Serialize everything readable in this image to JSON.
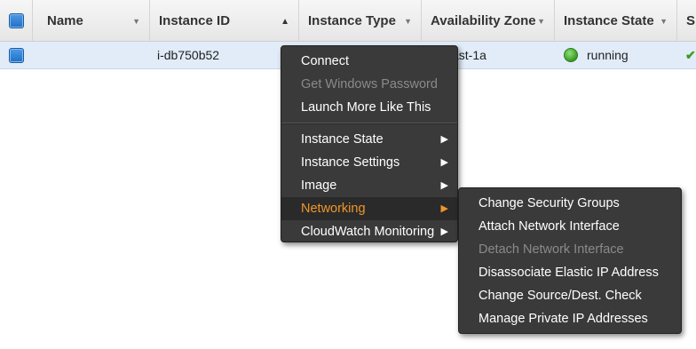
{
  "table": {
    "columns": [
      {
        "label": "Name"
      },
      {
        "label": "Instance ID"
      },
      {
        "label": "Instance Type"
      },
      {
        "label": "Availability Zone"
      },
      {
        "label": "Instance State"
      },
      {
        "label": "S"
      }
    ],
    "row": {
      "name": "",
      "instance_id": "i-db750b52",
      "availability_zone_visible": "ast-1a",
      "instance_state": "running"
    }
  },
  "context_menu": {
    "items": [
      {
        "label": "Connect"
      },
      {
        "label": "Get Windows Password"
      },
      {
        "label": "Launch More Like This"
      },
      {
        "label": "Instance State"
      },
      {
        "label": "Instance Settings"
      },
      {
        "label": "Image"
      },
      {
        "label": "Networking"
      },
      {
        "label": "CloudWatch Monitoring"
      }
    ]
  },
  "submenu": {
    "items": [
      {
        "label": "Change Security Groups"
      },
      {
        "label": "Attach Network Interface"
      },
      {
        "label": "Detach Network Interface"
      },
      {
        "label": "Disassociate Elastic IP Address"
      },
      {
        "label": "Change Source/Dest. Check"
      },
      {
        "label": "Manage Private IP Addresses"
      }
    ]
  },
  "colors": {
    "menu_bg": "#3a3a3a",
    "highlight_text": "#f0962a",
    "selected_row": "#e1ecf8",
    "status_green": "#3a9b23"
  }
}
